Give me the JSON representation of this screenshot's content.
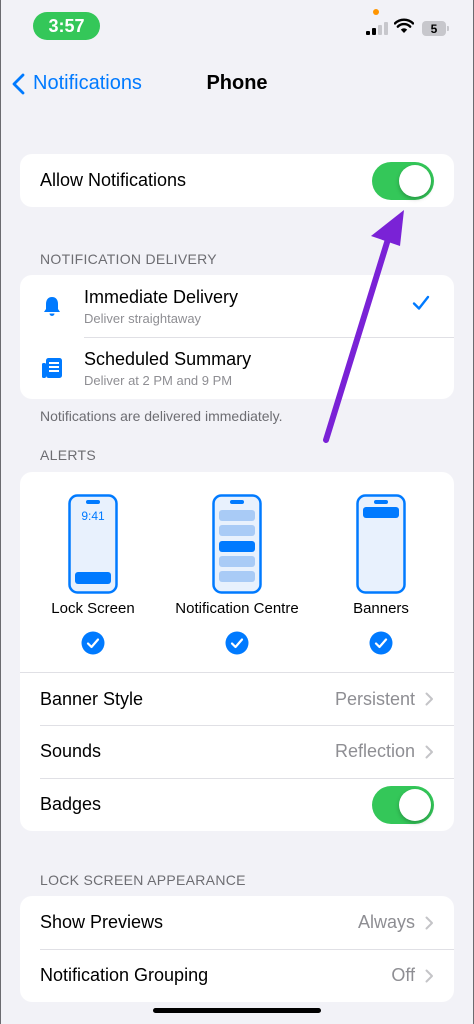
{
  "status_bar": {
    "time": "3:57",
    "battery": "5"
  },
  "nav": {
    "back_label": "Notifications",
    "title": "Phone"
  },
  "allow_notifications": {
    "label": "Allow Notifications",
    "on": true
  },
  "delivery": {
    "header": "NOTIFICATION DELIVERY",
    "items": [
      {
        "title": "Immediate Delivery",
        "subtitle": "Deliver straightaway",
        "selected": true,
        "icon": "bell-icon"
      },
      {
        "title": "Scheduled Summary",
        "subtitle": "Deliver at 2 PM and 9 PM",
        "selected": false,
        "icon": "summary-icon"
      }
    ],
    "footer": "Notifications are delivered immediately."
  },
  "alerts": {
    "header": "ALERTS",
    "styles": [
      {
        "label": "Lock Screen",
        "clock": "9:41",
        "checked": true
      },
      {
        "label": "Notification Centre",
        "checked": true
      },
      {
        "label": "Banners",
        "checked": true
      }
    ],
    "rows": [
      {
        "label": "Banner Style",
        "value": "Persistent"
      },
      {
        "label": "Sounds",
        "value": "Reflection"
      }
    ],
    "badges": {
      "label": "Badges",
      "on": true
    }
  },
  "lock_screen": {
    "header": "LOCK SCREEN APPEARANCE",
    "rows": [
      {
        "label": "Show Previews",
        "value": "Always"
      },
      {
        "label": "Notification Grouping",
        "value": "Off"
      }
    ]
  },
  "colors": {
    "accent": "#007aff",
    "toggle_on": "#34c759",
    "annotation_arrow": "#7a22d6"
  }
}
